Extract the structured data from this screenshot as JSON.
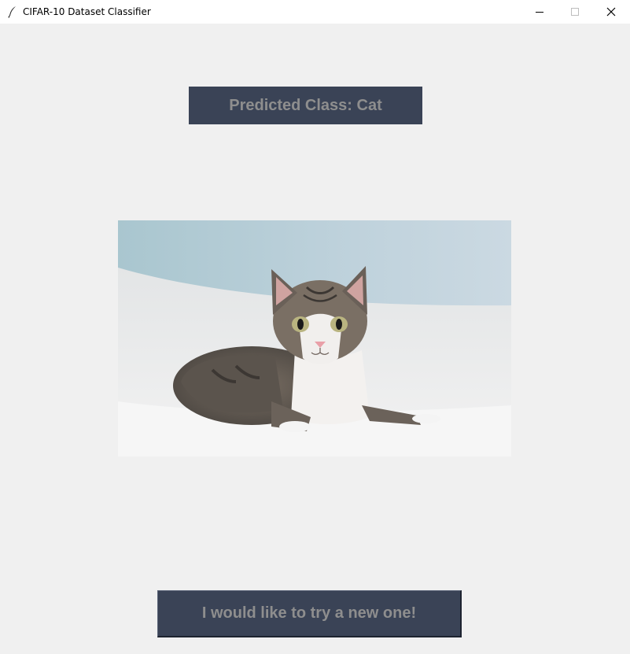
{
  "window": {
    "title": "CIFAR-10 Dataset Classifier",
    "icon": "feather-icon",
    "controls": [
      "minimize-icon",
      "maximize-icon",
      "close-icon"
    ]
  },
  "result": {
    "label": "Predicted Class: Cat"
  },
  "image": {
    "subject": "cat",
    "colors": {
      "sky": "#c3d5df",
      "bed": "#e9eaea"
    }
  },
  "actions": {
    "retry_label": "I would like to try a new one!"
  },
  "theme": {
    "background": "#f0f0f0",
    "panel": "#3a4356",
    "panel_text": "#8e8e8e"
  }
}
